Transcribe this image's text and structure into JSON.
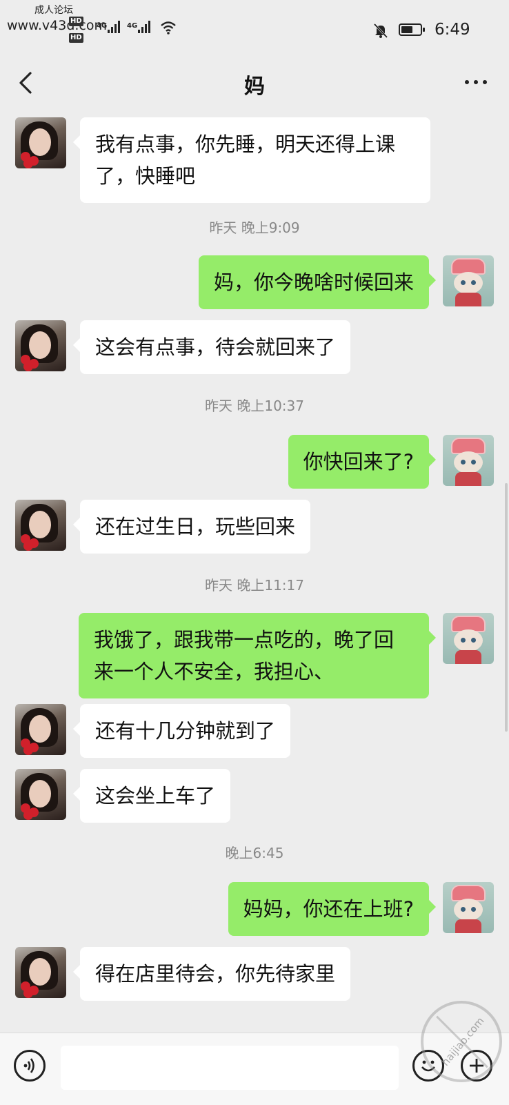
{
  "status_bar": {
    "watermark_top": "成人论坛",
    "watermark_url": "www.v43d.com",
    "network_1": "4G",
    "network_2": "4G",
    "hd_badge_1": "HD",
    "hd_badge_2": "HD",
    "time": "6:49"
  },
  "header": {
    "title": "妈"
  },
  "messages": [
    {
      "side": "in",
      "text_lines": [
        "我有点事，你先睡，明天还得上课",
        "了，快睡吧"
      ]
    },
    {
      "timestamp": "昨天 晚上9:09"
    },
    {
      "side": "out",
      "text_lines": [
        "妈，你今晚啥时候回来"
      ]
    },
    {
      "side": "in",
      "text_lines": [
        "这会有点事，待会就回来了"
      ]
    },
    {
      "timestamp": "昨天 晚上10:37"
    },
    {
      "side": "out",
      "text_lines": [
        "你快回来了?"
      ]
    },
    {
      "side": "in",
      "text_lines": [
        "还在过生日，玩些回来"
      ]
    },
    {
      "timestamp": "昨天 晚上11:17"
    },
    {
      "side": "out",
      "text_lines": [
        "我饿了，跟我带一点吃的，晚了回",
        "来一个人不安全，我担心、"
      ]
    },
    {
      "side": "in",
      "text_lines": [
        "还有十几分钟就到了"
      ]
    },
    {
      "side": "in",
      "text_lines": [
        "这会坐上车了"
      ]
    },
    {
      "timestamp": "晚上6:45"
    },
    {
      "side": "out",
      "text_lines": [
        "妈妈，你还在上班?"
      ]
    },
    {
      "side": "in",
      "text_lines": [
        "得在店里待会，你先待家里"
      ]
    }
  ],
  "watermark_stamp": {
    "text": "haijiao.com"
  },
  "icons": {
    "back": "chevron-left-icon",
    "more": "more-dots-icon",
    "voice": "voice-icon",
    "emoji": "emoji-icon",
    "plus": "plus-icon",
    "bell_muted": "bell-muted-icon",
    "wifi": "wifi-icon",
    "battery": "battery-icon"
  },
  "colors": {
    "background": "#ededed",
    "incoming_bubble": "#ffffff",
    "outgoing_bubble": "#95ec69"
  }
}
